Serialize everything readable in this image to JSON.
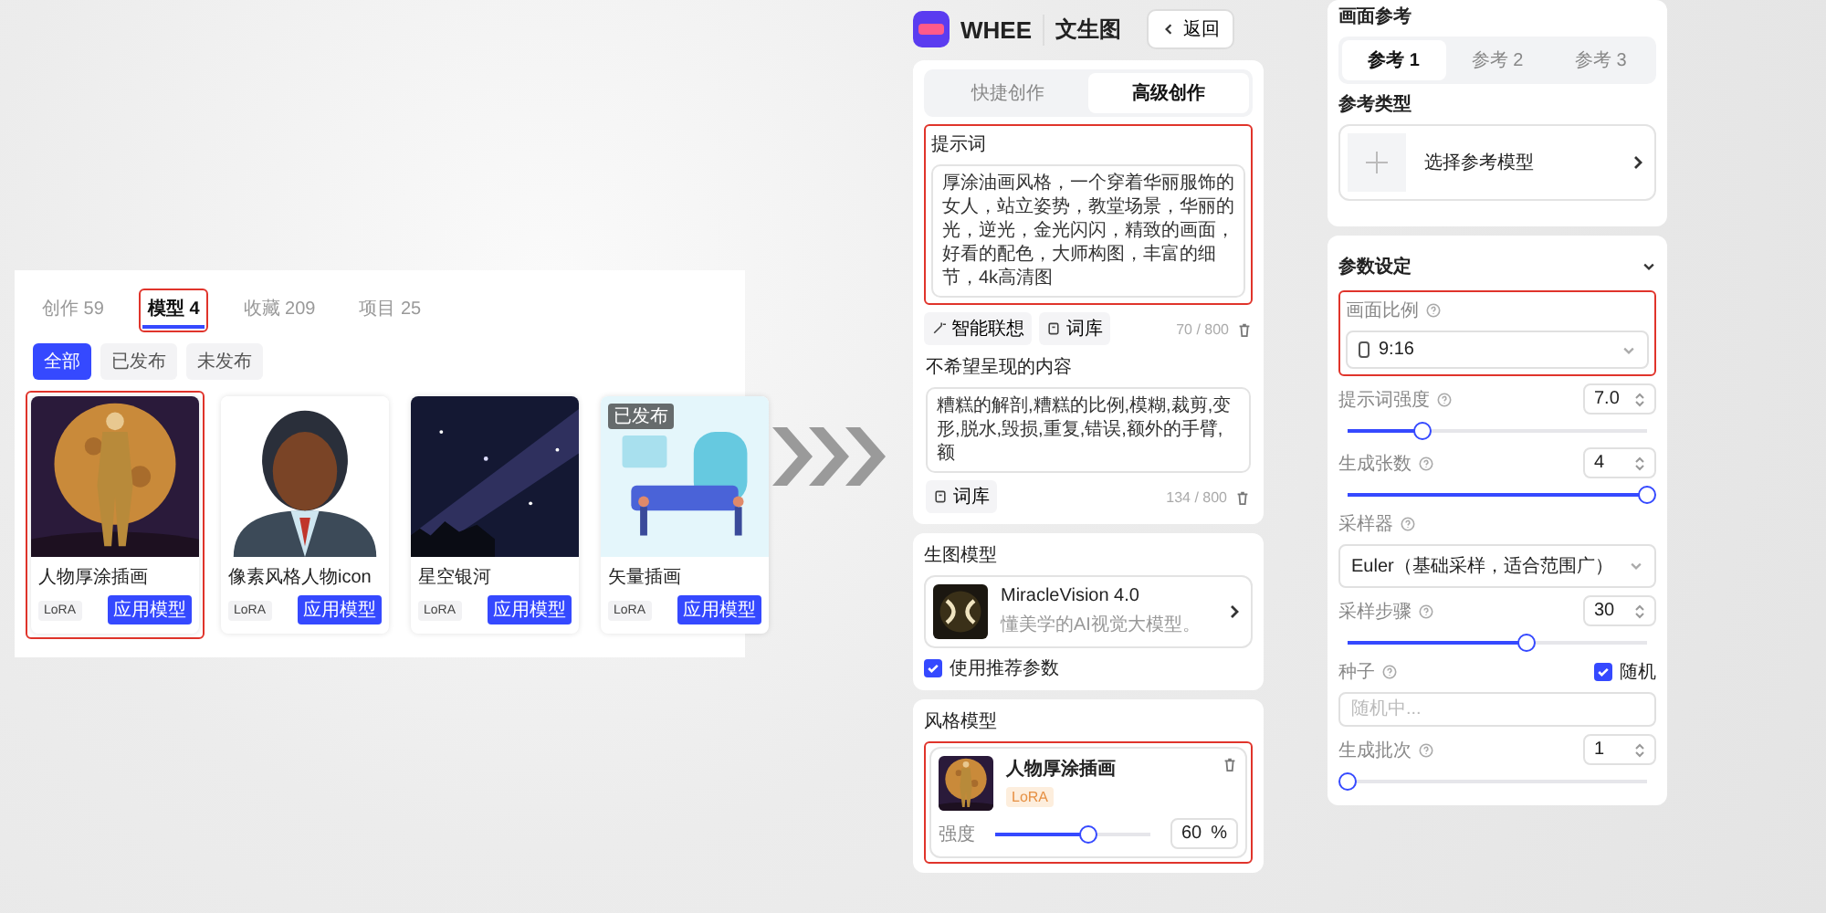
{
  "gallery": {
    "tabs": [
      {
        "label": "创作",
        "count": "59",
        "selected": false,
        "highlighted": false
      },
      {
        "label": "模型",
        "count": "4",
        "selected": true,
        "highlighted": true
      },
      {
        "label": "收藏",
        "count": "209",
        "selected": false,
        "highlighted": false
      },
      {
        "label": "项目",
        "count": "25",
        "selected": false,
        "highlighted": false
      }
    ],
    "filters": [
      {
        "label": "全部",
        "selected": true
      },
      {
        "label": "已发布",
        "selected": false
      },
      {
        "label": "未发布",
        "selected": false
      }
    ],
    "cards": [
      {
        "title": "人物厚涂插画",
        "tag": "LoRA",
        "action": "应用模型",
        "highlighted": true
      },
      {
        "title": "像素风格人物icon",
        "tag": "LoRA",
        "action": "应用模型",
        "highlighted": false
      },
      {
        "title": "星空银河",
        "tag": "LoRA",
        "action": "应用模型",
        "highlighted": false
      },
      {
        "title": "矢量插画",
        "tag": "LoRA",
        "action": "应用模型",
        "highlighted": false,
        "badge": "已发布"
      }
    ]
  },
  "editor": {
    "logo": "WHEE",
    "title": "文生图",
    "back": "返回",
    "modes": [
      {
        "label": "快捷创作",
        "selected": false
      },
      {
        "label": "高级创作",
        "selected": true
      }
    ],
    "prompt": {
      "label": "提示词",
      "text": "厚涂油画风格，一个穿着华丽服饰的女人，站立姿势，教堂场景，华丽的光，逆光，金光闪闪，精致的画面，好看的配色，大师构图，丰富的细节，4k高清图",
      "tools": [
        {
          "kind": "assist",
          "label": "智能联想"
        },
        {
          "kind": "library",
          "label": "词库"
        }
      ],
      "count": "70 / 800",
      "highlighted": true
    },
    "negative": {
      "label": "不希望呈现的内容",
      "text": "糟糕的解剖,糟糕的比例,模糊,裁剪,变形,脱水,毁损,重复,错误,额外的手臂,额",
      "tools": [
        {
          "kind": "library",
          "label": "词库"
        }
      ],
      "count": "134 / 800",
      "highlighted": false
    },
    "base_model": {
      "label": "生图模型",
      "name": "MiracleVision 4.0",
      "description": "懂美学的AI视觉大模型。",
      "option": {
        "label": "使用推荐参数",
        "checked": true
      }
    },
    "style_model": {
      "label": "风格模型",
      "name": "人物厚涂插画",
      "tag": "LoRA",
      "strength_label": "强度",
      "level": 0.6,
      "value": "60",
      "unit": "%",
      "highlighted": true
    }
  },
  "settings": {
    "reference": {
      "label": "画面参考",
      "tabs": [
        {
          "label": "参考 1",
          "selected": true
        },
        {
          "label": "参考 2",
          "selected": false
        },
        {
          "label": "参考 3",
          "selected": false
        }
      ],
      "type_label": "参考类型",
      "picker": "选择参考模型"
    },
    "params": {
      "title": "参数设定",
      "expanded": true,
      "items": [
        {
          "kind": "ratio",
          "label": "画面比例",
          "value": "9:16",
          "highlighted": true
        },
        {
          "kind": "number",
          "label": "提示词强度",
          "value": "7.0",
          "level": 0.25
        },
        {
          "kind": "number",
          "label": "生成张数",
          "value": "4",
          "level": 1
        },
        {
          "kind": "select",
          "label": "采样器",
          "value": "Euler（基础采样，适合范围广）"
        },
        {
          "kind": "number",
          "label": "采样步骤",
          "value": "30",
          "level": 0.6
        },
        {
          "kind": "seed",
          "label": "种子",
          "option": "随机",
          "checked": true,
          "placeholder": "随机中..."
        },
        {
          "kind": "number",
          "label": "生成批次",
          "value": "1",
          "level": 0
        }
      ]
    }
  }
}
